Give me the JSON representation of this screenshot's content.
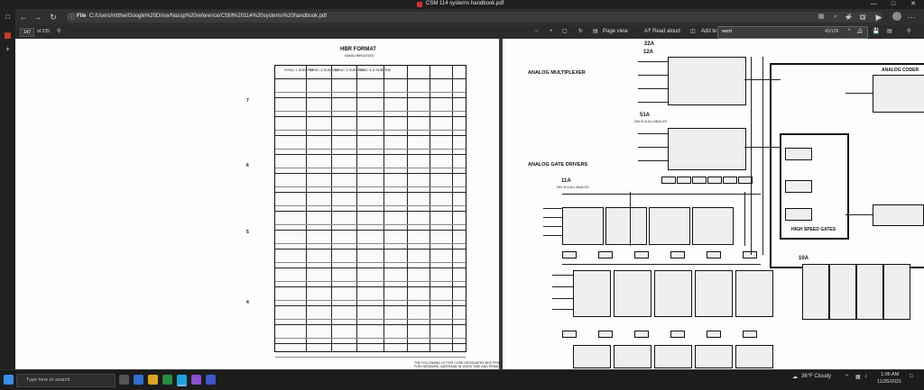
{
  "window": {
    "title": "CSM 114 systems handbook.pdf"
  },
  "browser": {
    "file_label": "File",
    "url": "C:/Users/mtthw/Google%20Drive/Nassp%20reference/CSM%20114%20systems%20handbook.pdf"
  },
  "pdf_toolbar": {
    "page_number": "147",
    "page_total": "of 235",
    "page_view": "Page view",
    "read_aloud": "Read aloud",
    "add_text": "Add te",
    "find_query": "word",
    "find_count": "45/109"
  },
  "left_page": {
    "title": "HBR FORMAT",
    "subtitle": "NAMS-HBR01/02/03",
    "col_headers": [
      "SYNC 1 SUBFRM",
      "SYNC 2 SUBFRM",
      "SYNC 3 SUBFRM",
      "SYNC 4-5 SUBFRM"
    ],
    "row_markers": [
      "7",
      "6",
      "5",
      "4"
    ],
    "footnote_1": "THE FOLLOWING LETTER CODE DESIGNATES BOX PRIME FRAMES",
    "footnote_2": "FOR HARDWIRE SUBFRAME IN WORD TIME AND PRIME FRAME"
  },
  "right_page": {
    "analog_multiplexer": "ANALOG MULTIPLEXER",
    "analog_gate_drivers": "ANALOG GATE DRIVERS",
    "analog_coder": "ANALOG CODER",
    "high_speed_gates": "HIGH SPEED GATES",
    "chip_22a": "22A",
    "chip_12a": "12A",
    "chip_51a": "51A",
    "chip_11a": "11A",
    "chip_10a": "10A",
    "sub_51a": "DIN 51 A ALL ANALOG",
    "sub_11a": "DIN 11 A ALL ANALOG"
  },
  "taskbar": {
    "search_placeholder": "Type here to search",
    "weather": "36°F  Cloudy",
    "time": "1:06 AM",
    "date": "11/26/2021"
  }
}
